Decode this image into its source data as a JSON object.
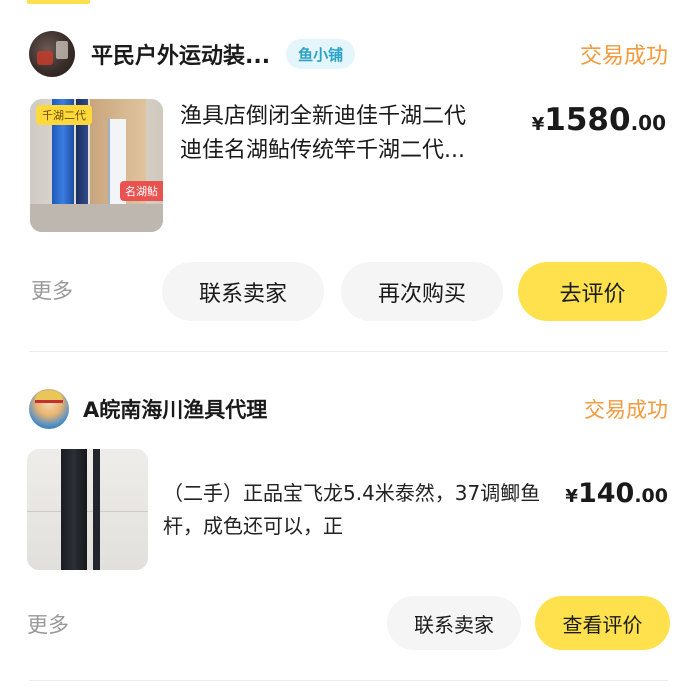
{
  "orders": [
    {
      "shop_name": "平民户外运动装...",
      "shop_badge": "鱼小铺",
      "status": "交易成功",
      "product": {
        "title_line1": "渔具店倒闭全新迪佳千湖二代",
        "title_line2": "迪佳名湖鲇传统竿千湖二代...",
        "image_tag": "千湖二代",
        "image_tag2": "名湖鲇"
      },
      "price": {
        "currency": "¥",
        "integer": "1580",
        "decimal": ".00"
      },
      "more_label": "更多",
      "actions": {
        "contact": "联系卖家",
        "rebuy": "再次购买",
        "review": "去评价"
      }
    },
    {
      "shop_name": "A皖南海川渔具代理",
      "status": "交易成功",
      "product": {
        "title": "（二手）正品宝飞龙5.4米泰然，37调鲫鱼杆，成色还可以，正"
      },
      "price": {
        "currency": "¥",
        "integer": "140",
        "decimal": ".00"
      },
      "more_label": "更多",
      "actions": {
        "contact": "联系卖家",
        "view_review": "查看评价"
      }
    }
  ],
  "colors": {
    "accent_yellow": "#ffe14d",
    "status_orange": "#f39a3d",
    "badge_blue": "#2aa3c8",
    "badge_bg": "#e4f5fb",
    "button_gray": "#f5f5f5",
    "muted_text": "#999999"
  }
}
